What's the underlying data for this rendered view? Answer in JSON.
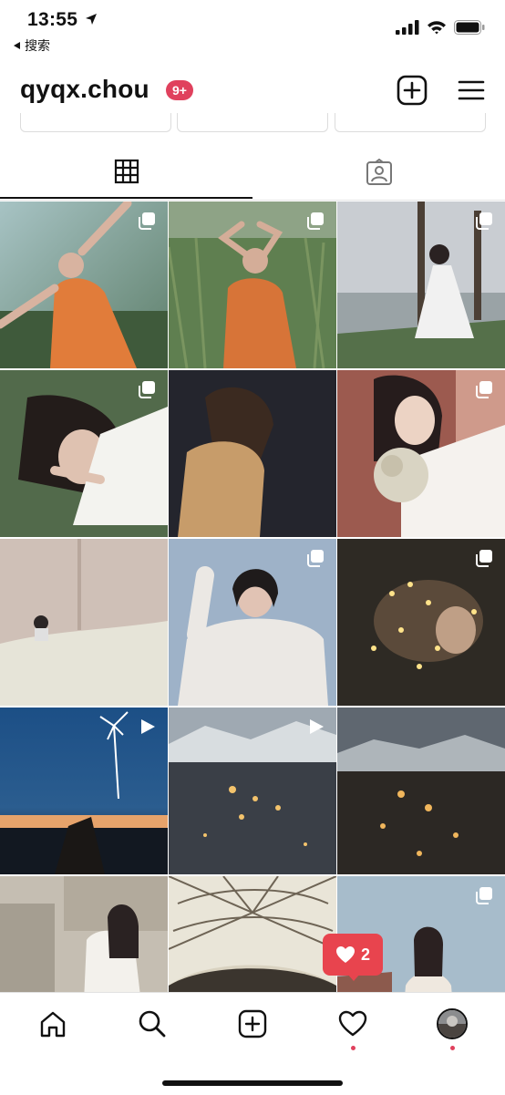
{
  "status_bar": {
    "time": "13:55",
    "back_app": "搜索"
  },
  "profile": {
    "username": "qyqx.chou",
    "notification_count": "9+"
  },
  "tabs": [
    {
      "name": "grid",
      "selected": true
    },
    {
      "name": "tagged",
      "selected": false
    }
  ],
  "posts": [
    {
      "type": "carousel"
    },
    {
      "type": "carousel"
    },
    {
      "type": "carousel"
    },
    {
      "type": "carousel"
    },
    {
      "type": "image"
    },
    {
      "type": "carousel"
    },
    {
      "type": "image"
    },
    {
      "type": "carousel"
    },
    {
      "type": "carousel"
    },
    {
      "type": "video"
    },
    {
      "type": "video"
    },
    {
      "type": "image"
    },
    {
      "type": "image"
    },
    {
      "type": "image"
    },
    {
      "type": "carousel"
    }
  ],
  "like_toast": {
    "count": "2"
  },
  "colors": {
    "badge": "#e0415d",
    "toast": "#e8444e"
  }
}
